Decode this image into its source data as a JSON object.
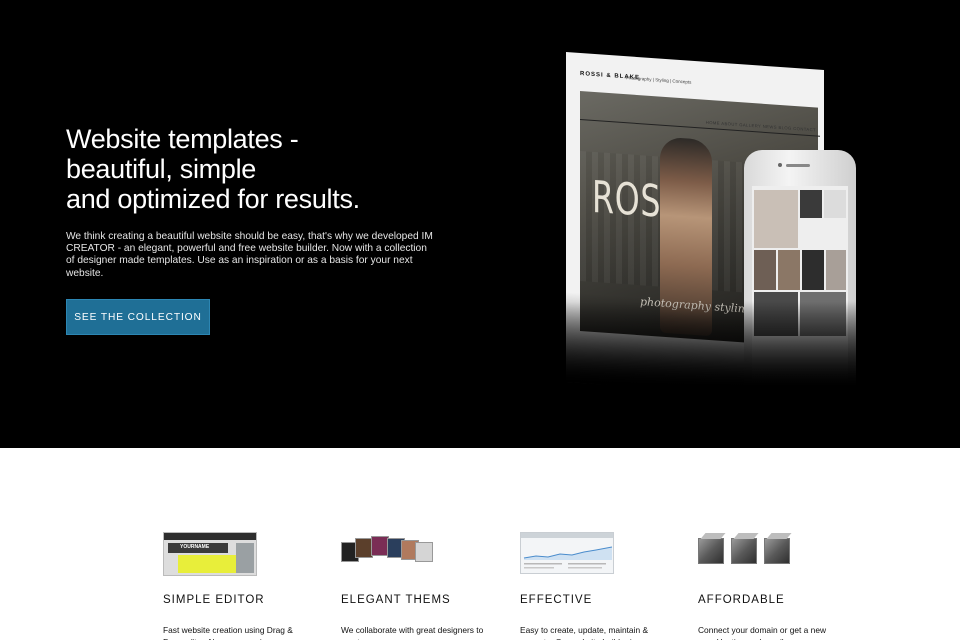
{
  "hero": {
    "headline": [
      "Website templates -",
      "beautiful, simple",
      "and optimized for results."
    ],
    "intro": "We think creating a beautiful website should be easy, that's why we developed IM CREATOR - an elegant, powerful and free website builder. Now with a collection of designer made templates. Use as an inspiration or as a basis for your next website.",
    "cta_label": "SEE THE COLLECTION",
    "cta_color": "#1f6f96"
  },
  "mockup": {
    "brand": "ROSSI & BLAKE",
    "subtitle": "Photography | Styling | Concepts",
    "nav": "HOME ABOUT GALLERY NEWS BLOG CONTACT",
    "big_letters": "ROSSI",
    "script_text": "photography   styling"
  },
  "features": [
    {
      "title": "SIMPLE EDITOR",
      "text": "Fast website creation using Drag & Drop editor. No programming",
      "thumb_label": "YOURNAME"
    },
    {
      "title": "ELEGANT THEMS",
      "text": "We collaborate with great designers to create an"
    },
    {
      "title": "EFFECTIVE",
      "text": "Easy to create, update, maintain & promote. Our website builder is"
    },
    {
      "title": "AFFORDABLE",
      "text": "Connect your domain or get a new one. Hosting and email"
    }
  ]
}
